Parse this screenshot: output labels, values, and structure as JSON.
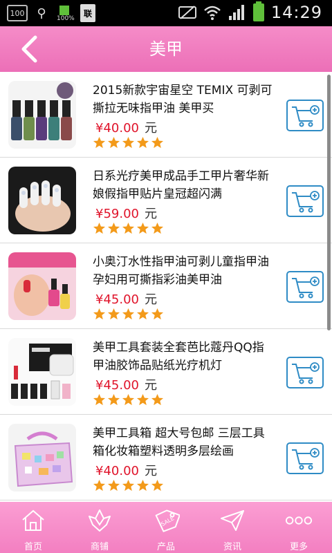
{
  "status_bar": {
    "notification_box": "100",
    "battery_small_label": "100%",
    "sim_label": "联",
    "time": "14:29"
  },
  "header": {
    "title": "美甲",
    "background_color": "#ef79bd"
  },
  "products": [
    {
      "name": "2015新款宇宙星空 TEMIX 可剥可撕拉无味指甲油 美甲买",
      "price": "¥40.00",
      "unit": "元",
      "rating": 5,
      "image": "nail-polish-bottles"
    },
    {
      "name": "日系光疗美甲成品手工甲片奢华新娘假指甲贴片皇冠超闪满",
      "price": "¥59.00",
      "unit": "元",
      "rating": 5,
      "image": "nail-art-hand"
    },
    {
      "name": "小奥汀水性指甲油可剥儿童指甲油孕妇用可撕指彩油美甲油",
      "price": "¥45.00",
      "unit": "元",
      "rating": 5,
      "image": "kids-nail-polish"
    },
    {
      "name": "美甲工具套装全套芭比蔻丹QQ指甲油胶饰品贴纸光疗机灯",
      "price": "¥45.00",
      "unit": "元",
      "rating": 5,
      "image": "uv-lamp-kit"
    },
    {
      "name": "美甲工具箱 超大号包邮 三层工具箱化妆箱塑料透明多层绘画",
      "price": "¥40.00",
      "unit": "元",
      "rating": 5,
      "image": "tool-box"
    }
  ],
  "bottom_nav": [
    {
      "label": "首页",
      "icon": "home-icon"
    },
    {
      "label": "商铺",
      "icon": "shop-icon"
    },
    {
      "label": "产品",
      "icon": "tag-icon"
    },
    {
      "label": "资讯",
      "icon": "paper-plane-icon"
    },
    {
      "label": "更多",
      "icon": "more-icon"
    }
  ],
  "colors": {
    "accent_pink": "#ef79bd",
    "price_red": "#e0142b",
    "cart_blue": "#2e8bc5",
    "star_orange": "#f39a1a"
  }
}
